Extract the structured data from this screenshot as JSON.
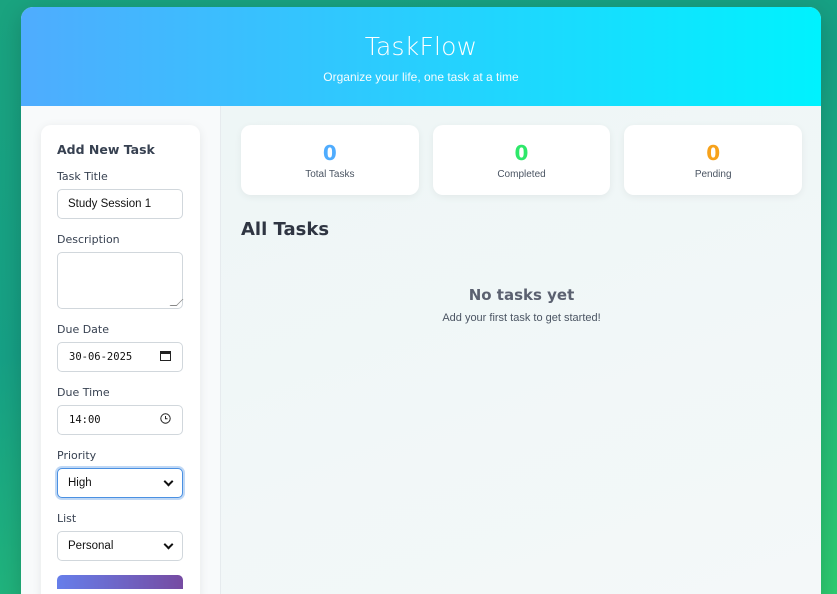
{
  "header": {
    "title": "TaskFlow",
    "subtitle": "Organize your life, one task at a time"
  },
  "form": {
    "heading": "Add New Task",
    "title_label": "Task Title",
    "title_value": "Study Session 1",
    "description_label": "Description",
    "description_value": "",
    "due_date_label": "Due Date",
    "due_date_value": "30-06-2025",
    "due_time_label": "Due Time",
    "due_time_value": "14:00",
    "priority_label": "Priority",
    "priority_value": "High",
    "list_label": "List",
    "list_value": "Personal"
  },
  "stats": [
    {
      "value": "0",
      "label": "Total Tasks",
      "color": "#4facfe"
    },
    {
      "value": "0",
      "label": "Completed",
      "color": "#2ee86a"
    },
    {
      "value": "0",
      "label": "Pending",
      "color": "#f7a21b"
    }
  ],
  "tasks": {
    "heading": "All Tasks",
    "empty_title": "No tasks yet",
    "empty_message": "Add your first task to get started!"
  },
  "icons": {
    "calendar": "calendar-icon",
    "clock": "clock-icon",
    "chevron": "chevron-down-icon"
  }
}
